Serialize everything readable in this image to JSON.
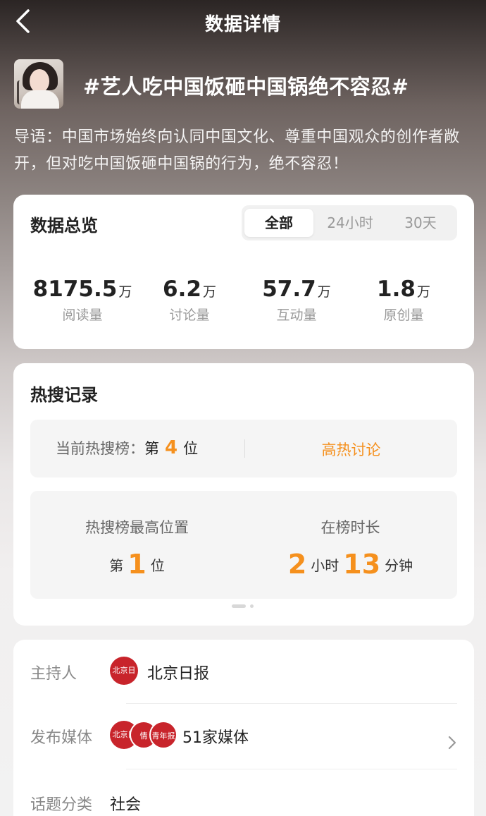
{
  "nav": {
    "title": "数据详情"
  },
  "topic": {
    "title": "#艺人吃中国饭砸中国锅绝不容忍#",
    "intro": "导语：中国市场始终向认同中国文化、尊重中国观众的创作者敞开，但对吃中国饭砸中国锅的行为，绝不容忍！"
  },
  "overview": {
    "title": "数据总览",
    "tabs": [
      "全部",
      "24小时",
      "30天"
    ],
    "active_tab": "全部",
    "stats": [
      {
        "value": "8175.5",
        "unit": "万",
        "label": "阅读量"
      },
      {
        "value": "6.2",
        "unit": "万",
        "label": "讨论量"
      },
      {
        "value": "57.7",
        "unit": "万",
        "label": "互动量"
      },
      {
        "value": "1.8",
        "unit": "万",
        "label": "原创量"
      }
    ]
  },
  "hot_search": {
    "title": "热搜记录",
    "current_label": "当前热搜榜：",
    "current_prefix": "第",
    "current_rank": "4",
    "current_suffix": "位",
    "heat_tag": "高热讨论",
    "peak_label": "热搜榜最高位置",
    "peak_prefix": "第",
    "peak_rank": "1",
    "peak_suffix": "位",
    "duration_label": "在榜时长",
    "duration_hours": "2",
    "hours_unit": "小时",
    "duration_minutes": "13",
    "minutes_unit": "分钟"
  },
  "info": {
    "host_label": "主持人",
    "host_value": "北京日报",
    "media_label": "发布媒体",
    "media_value": "51家媒体",
    "category_label": "话题分类",
    "category_value": "社会"
  },
  "colors": {
    "accent": "#f5901d",
    "seal": "#c8242b"
  }
}
